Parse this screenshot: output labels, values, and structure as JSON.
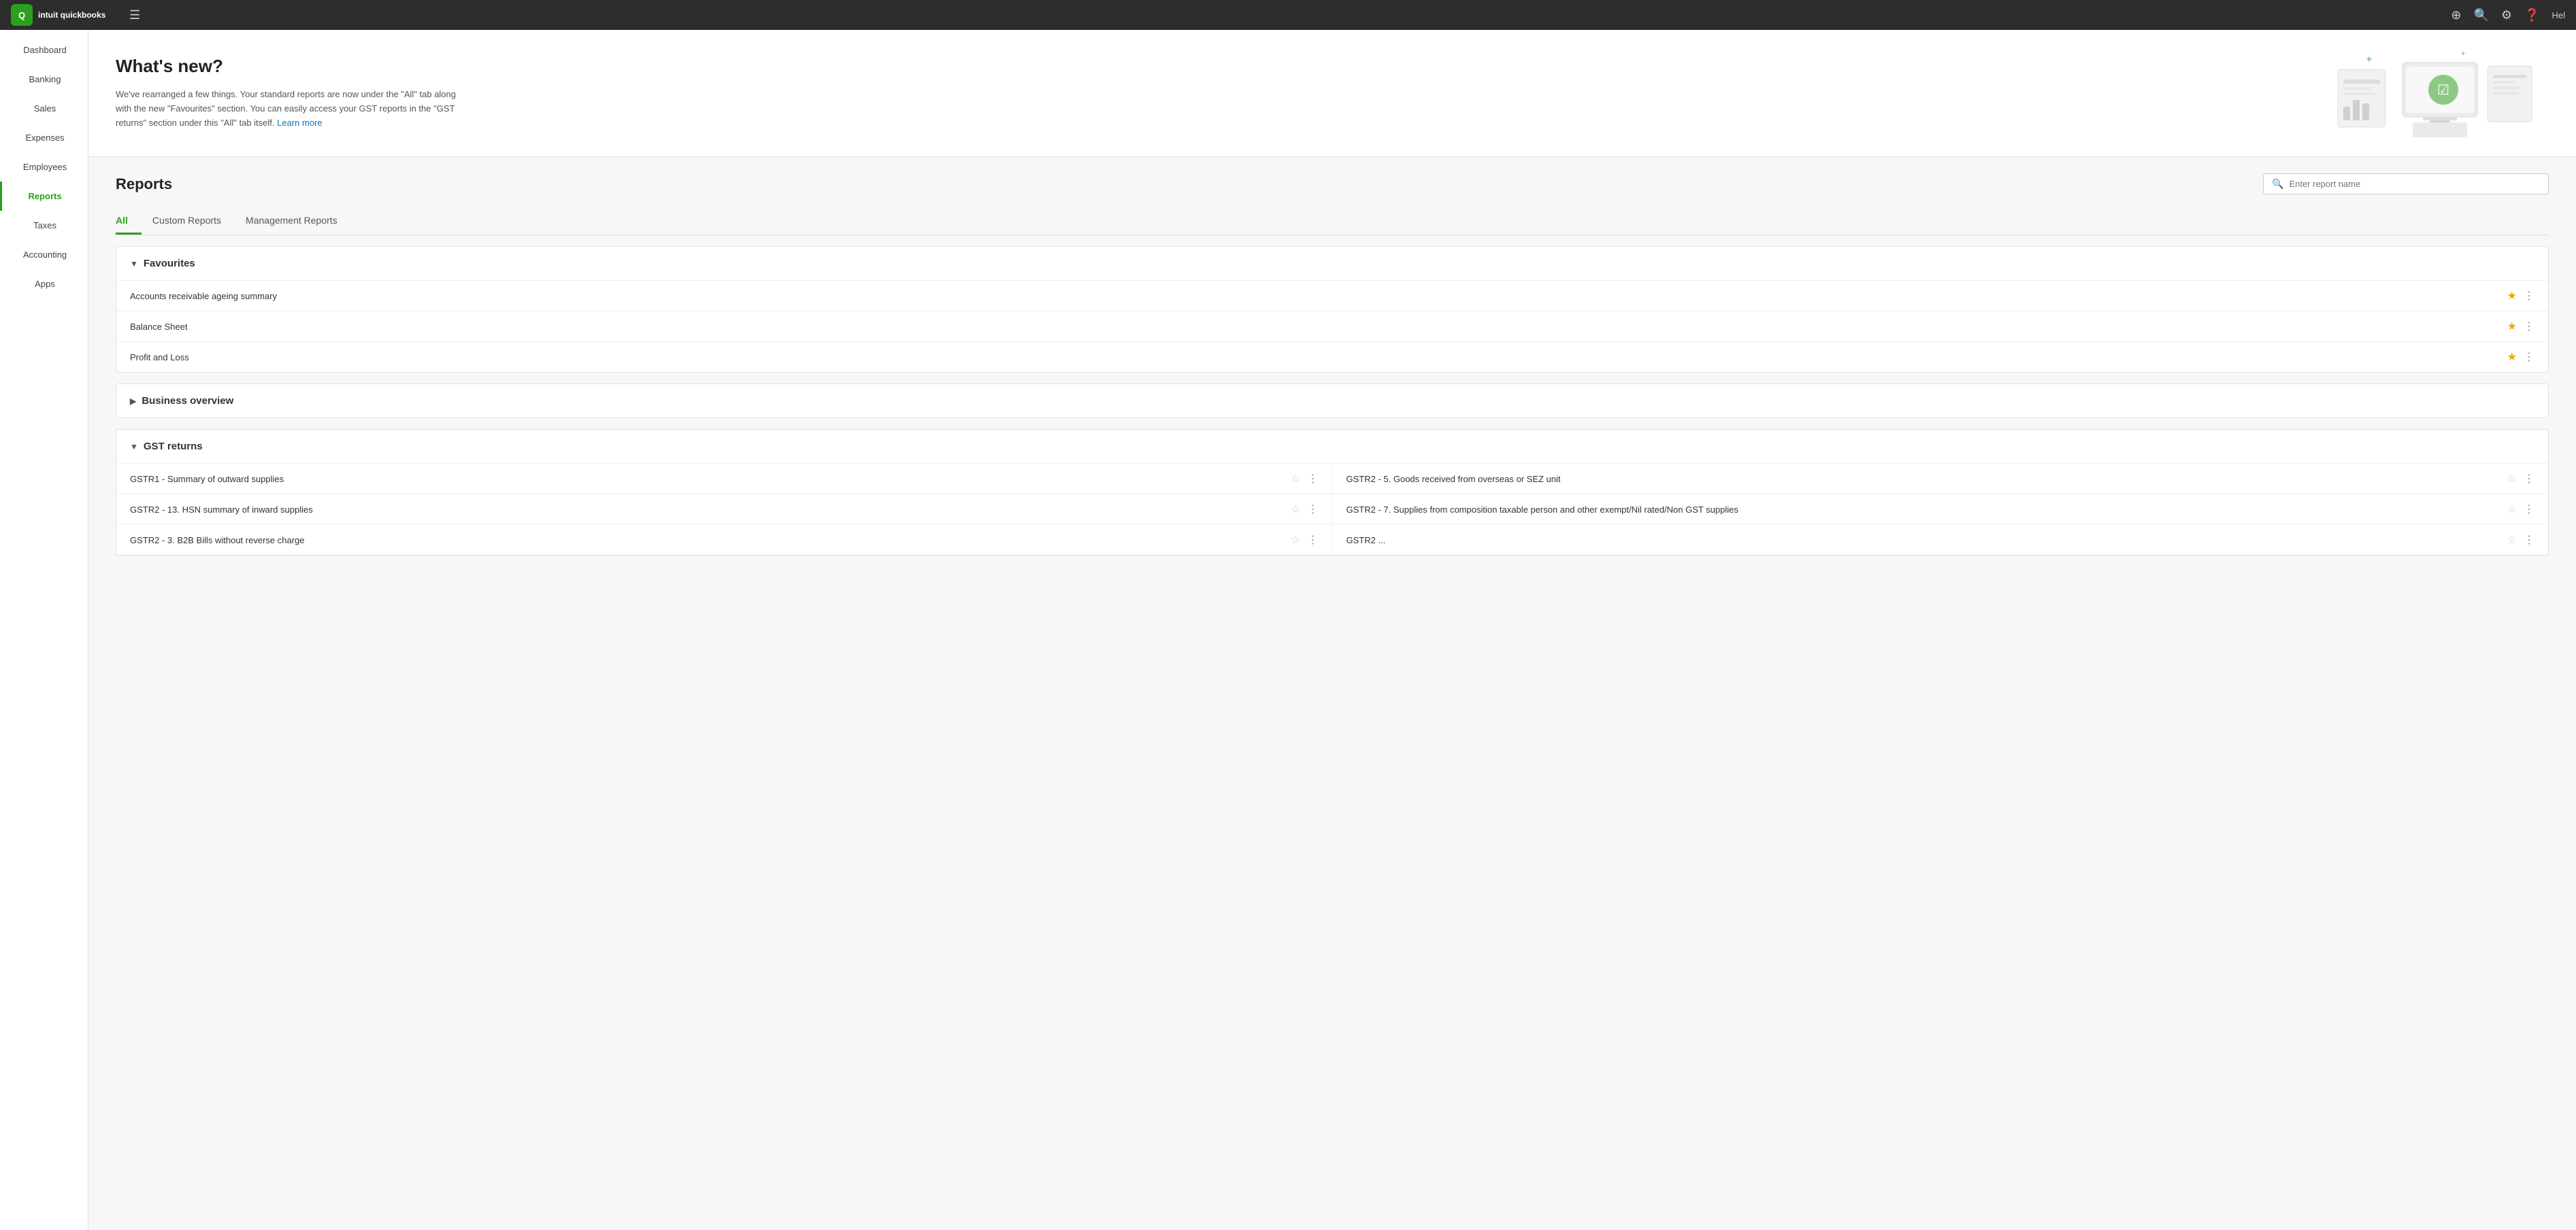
{
  "topnav": {
    "logo_text": "intuit quickbooks",
    "logo_abbr": "QB",
    "help_label": "Hel",
    "icons": [
      "plus-icon",
      "search-icon",
      "gear-icon",
      "help-icon"
    ]
  },
  "sidebar": {
    "items": [
      {
        "label": "Dashboard",
        "active": false
      },
      {
        "label": "Banking",
        "active": false
      },
      {
        "label": "Sales",
        "active": false
      },
      {
        "label": "Expenses",
        "active": false
      },
      {
        "label": "Employees",
        "active": false
      },
      {
        "label": "Reports",
        "active": true
      },
      {
        "label": "Taxes",
        "active": false
      },
      {
        "label": "Accounting",
        "active": false
      },
      {
        "label": "Apps",
        "active": false
      }
    ]
  },
  "banner": {
    "title": "What's new?",
    "body": "We've rearranged a few things. Your standard reports are now under the \"All\" tab along with the new \"Favourites\" section. You can easily access your GST reports in the \"GST returns\" section under this \"All\" tab itself.",
    "link_text": "Learn more",
    "link_url": "#"
  },
  "reports": {
    "title": "Reports",
    "search_placeholder": "Enter report name",
    "tabs": [
      {
        "label": "All",
        "active": true
      },
      {
        "label": "Custom Reports",
        "active": false
      },
      {
        "label": "Management Reports",
        "active": false
      }
    ],
    "favourites": {
      "section_title": "Favourites",
      "expanded": true,
      "items": [
        {
          "name": "Accounts receivable ageing summary",
          "starred": true
        },
        {
          "name": "Balance Sheet",
          "starred": true
        },
        {
          "name": "Profit and Loss",
          "starred": true
        }
      ]
    },
    "business_overview": {
      "section_title": "Business overview",
      "expanded": false
    },
    "gst_returns": {
      "section_title": "GST returns",
      "expanded": true,
      "left_items": [
        {
          "name": "GSTR1 - Summary of outward supplies",
          "starred": false
        },
        {
          "name": "GSTR2 - 13. HSN summary of inward supplies",
          "starred": false
        },
        {
          "name": "GSTR2 - 3. B2B Bills without reverse charge",
          "starred": false
        }
      ],
      "right_items": [
        {
          "name": "GSTR2 - 5. Goods received from overseas or SEZ unit",
          "starred": false
        },
        {
          "name": "GSTR2 - 7. Supplies from composition taxable person and other exempt/Nil rated/Non GST supplies",
          "starred": false
        },
        {
          "name": "GSTR2 ...",
          "starred": false
        }
      ]
    }
  }
}
